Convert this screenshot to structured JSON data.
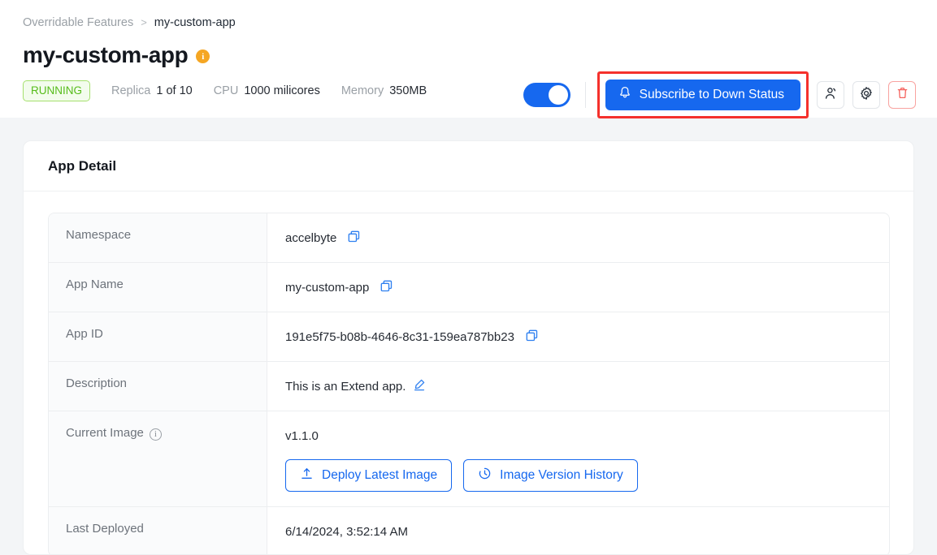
{
  "breadcrumb": {
    "parent": "Overridable Features",
    "separator": ">",
    "current": "my-custom-app"
  },
  "header": {
    "title": "my-custom-app",
    "info_icon": "info-circle-icon",
    "info_letter": "i",
    "status": "RUNNING",
    "meta": [
      {
        "label": "Replica",
        "value": "1 of 10"
      },
      {
        "label": "CPU",
        "value": "1000 milicores"
      },
      {
        "label": "Memory",
        "value": "350MB"
      }
    ],
    "toggle": {
      "name": "app-enabled-toggle",
      "state": "on"
    },
    "subscribe_button": {
      "label": "Subscribe to Down Status",
      "icon": "bell-icon",
      "highlighted": true
    },
    "icon_buttons": [
      {
        "name": "manage-access-button",
        "icon": "user-icon"
      },
      {
        "name": "settings-button",
        "icon": "gear-icon"
      },
      {
        "name": "delete-app-button",
        "icon": "trash-icon"
      }
    ]
  },
  "colors": {
    "accent": "#1668ef",
    "danger": "#f5312c",
    "warning": "#f5a623",
    "status_running_text": "#56bc1a",
    "status_running_bg": "#f3fced",
    "status_running_border": "#a5e06d",
    "page_bg": "#f3f5f7"
  },
  "card": {
    "title": "App Detail",
    "rows": [
      {
        "label": "Namespace",
        "value": "accelbyte",
        "copy": true,
        "copy_icon": "copy-icon"
      },
      {
        "label": "App Name",
        "value": "my-custom-app",
        "copy": true,
        "copy_icon": "copy-icon"
      },
      {
        "label": "App ID",
        "value": "191e5f75-b08b-4646-8c31-159ea787bb23",
        "copy": true,
        "copy_icon": "copy-icon"
      },
      {
        "label": "Description",
        "value": "This is an Extend app.",
        "edit": true,
        "edit_icon": "pencil-icon"
      },
      {
        "label": "Current Image",
        "label_info_icon": "info-circle-icon",
        "value": "v1.1.0",
        "buttons": [
          {
            "label": "Deploy Latest Image",
            "icon": "upload-icon"
          },
          {
            "label": "Image Version History",
            "icon": "history-clock-icon"
          }
        ]
      },
      {
        "label": "Last Deployed",
        "value": "6/14/2024, 3:52:14 AM"
      }
    ]
  }
}
